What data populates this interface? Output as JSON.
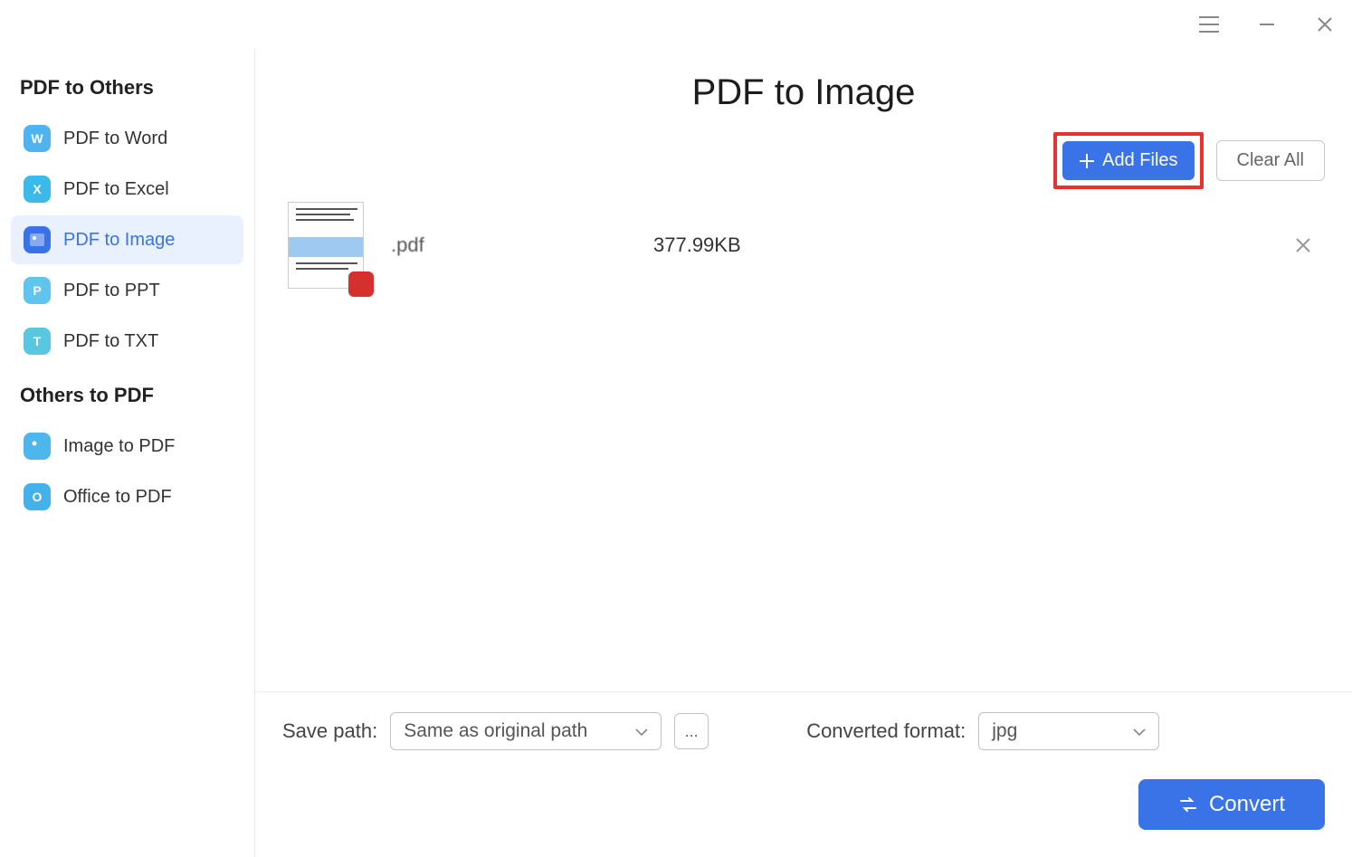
{
  "window": {
    "menu_icon": "menu",
    "minimize_icon": "minimize",
    "close_icon": "close"
  },
  "sidebar": {
    "section1_title": "PDF to Others",
    "section2_title": "Others to PDF",
    "items": [
      {
        "label": "PDF to Word",
        "icon_letter": "W",
        "active": false
      },
      {
        "label": "PDF to Excel",
        "icon_letter": "X",
        "active": false
      },
      {
        "label": "PDF to Image",
        "icon_letter": "",
        "active": true
      },
      {
        "label": "PDF to PPT",
        "icon_letter": "P",
        "active": false
      },
      {
        "label": "PDF to TXT",
        "icon_letter": "T",
        "active": false
      }
    ],
    "items2": [
      {
        "label": "Image to PDF",
        "icon_letter": ""
      },
      {
        "label": "Office to PDF",
        "icon_letter": "O"
      }
    ]
  },
  "main": {
    "title": "PDF to Image",
    "add_files_label": "Add Files",
    "clear_all_label": "Clear All",
    "files": [
      {
        "name": ".pdf",
        "size": "377.99KB"
      }
    ]
  },
  "bottom": {
    "save_path_label": "Save path:",
    "save_path_value": "Same as original path",
    "browse_label": "...",
    "format_label": "Converted format:",
    "format_value": "jpg",
    "convert_label": "Convert"
  }
}
